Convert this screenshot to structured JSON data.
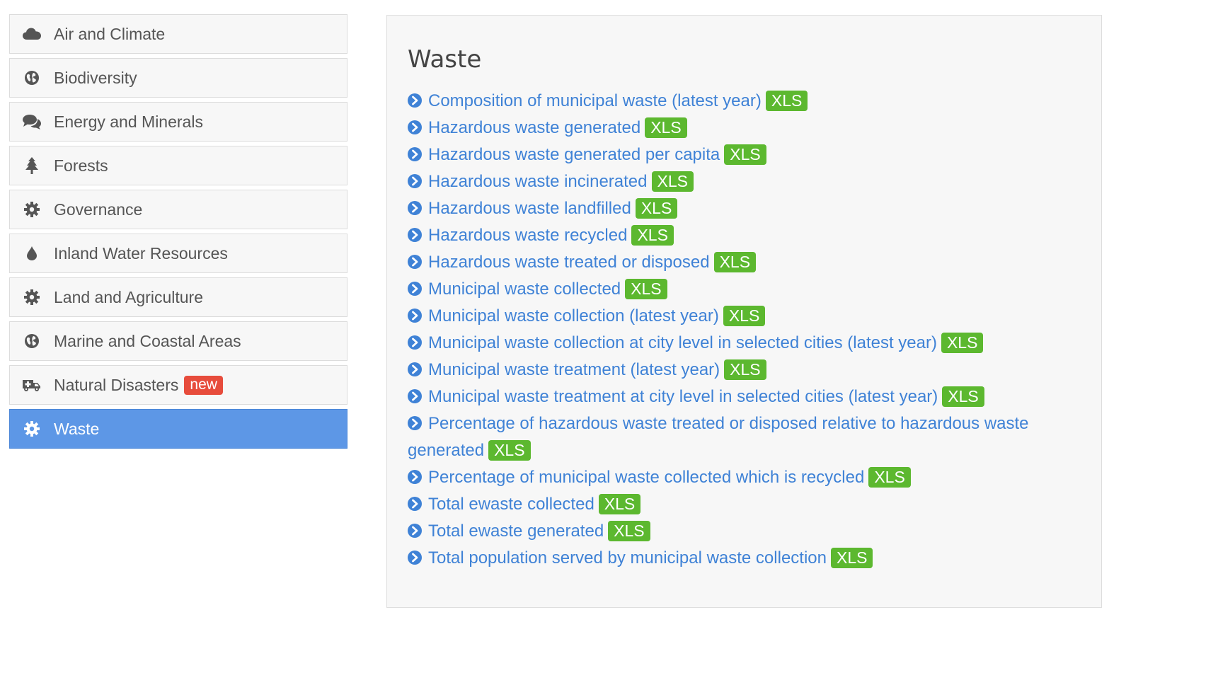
{
  "sidebar": {
    "items": [
      {
        "label": "Air and Climate",
        "icon": "cloud-icon",
        "active": false
      },
      {
        "label": "Biodiversity",
        "icon": "globe-icon",
        "active": false
      },
      {
        "label": "Energy and Minerals",
        "icon": "comments-icon",
        "active": false
      },
      {
        "label": "Forests",
        "icon": "tree-icon",
        "active": false
      },
      {
        "label": "Governance",
        "icon": "gear-icon",
        "active": false
      },
      {
        "label": "Inland Water Resources",
        "icon": "water-drop-icon",
        "active": false
      },
      {
        "label": "Land and Agriculture",
        "icon": "gear-icon",
        "active": false
      },
      {
        "label": "Marine and Coastal Areas",
        "icon": "globe-icon",
        "active": false
      },
      {
        "label": "Natural Disasters",
        "icon": "ambulance-icon",
        "active": false,
        "badge": "new"
      },
      {
        "label": "Waste",
        "icon": "gear-icon",
        "active": true
      }
    ]
  },
  "panel": {
    "title": "Waste",
    "badge_label": "XLS",
    "links": [
      {
        "text": "Composition of municipal waste (latest year)"
      },
      {
        "text": "Hazardous waste generated"
      },
      {
        "text": "Hazardous waste generated per capita"
      },
      {
        "text": "Hazardous waste incinerated"
      },
      {
        "text": "Hazardous waste landfilled"
      },
      {
        "text": "Hazardous waste recycled"
      },
      {
        "text": "Hazardous waste treated or disposed"
      },
      {
        "text": "Municipal waste collected"
      },
      {
        "text": "Municipal waste collection (latest year)"
      },
      {
        "text": "Municipal waste collection at city level in selected cities (latest year)"
      },
      {
        "text": "Municipal waste treatment (latest year)"
      },
      {
        "text": "Municipal waste treatment at city level in selected cities (latest year)"
      },
      {
        "text": "Percentage of hazardous waste treated or disposed relative to hazardous waste generated"
      },
      {
        "text": "Percentage of municipal waste collected which is recycled"
      },
      {
        "text": "Total ewaste collected"
      },
      {
        "text": "Total ewaste generated"
      },
      {
        "text": "Total population served by municipal waste collection"
      }
    ]
  },
  "colors": {
    "active_bg": "#5d97e6",
    "link": "#3f82d6",
    "xls_badge": "#5cb82f",
    "new_badge": "#e74c3c"
  }
}
